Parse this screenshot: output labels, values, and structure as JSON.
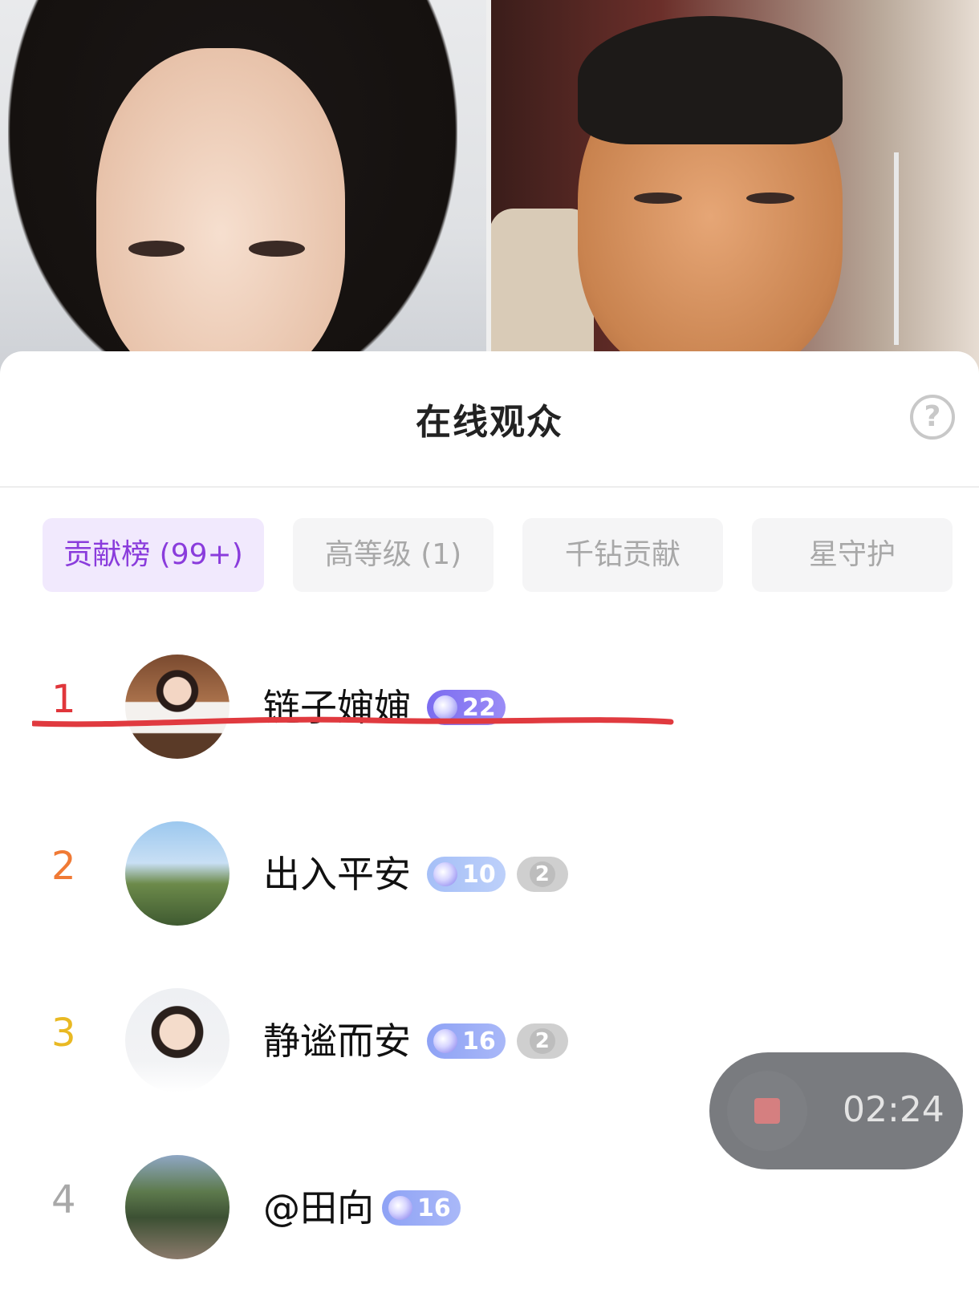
{
  "panel": {
    "title": "在线观众",
    "help_icon": "?"
  },
  "tabs": [
    {
      "label": "贡献榜 (99+)",
      "active": true
    },
    {
      "label": "高等级 (1)",
      "active": false
    },
    {
      "label": "千钻贡献",
      "active": false
    },
    {
      "label": "星守护",
      "active": false
    }
  ],
  "viewers": [
    {
      "rank": "1",
      "name": "链子婶婶",
      "level": "22",
      "level_style": "purple",
      "fan_badge": "",
      "rank_color": "#e0363b"
    },
    {
      "rank": "2",
      "name": "出入平安",
      "level": "10",
      "level_style": "lightblue",
      "fan_badge": "2",
      "rank_color": "#f07a35"
    },
    {
      "rank": "3",
      "name": "静谧而安",
      "level": "16",
      "level_style": "blue",
      "fan_badge": "2",
      "rank_color": "#e9b923"
    },
    {
      "rank": "4",
      "name": "@田向",
      "level": "16",
      "level_style": "blue",
      "fan_badge": "",
      "rank_color": "#a8a8a8"
    }
  ],
  "recording": {
    "time": "02:24",
    "stop_icon": "stop-icon"
  },
  "colors": {
    "accent": "#8a3cdc",
    "underline": "#e03a3f"
  }
}
